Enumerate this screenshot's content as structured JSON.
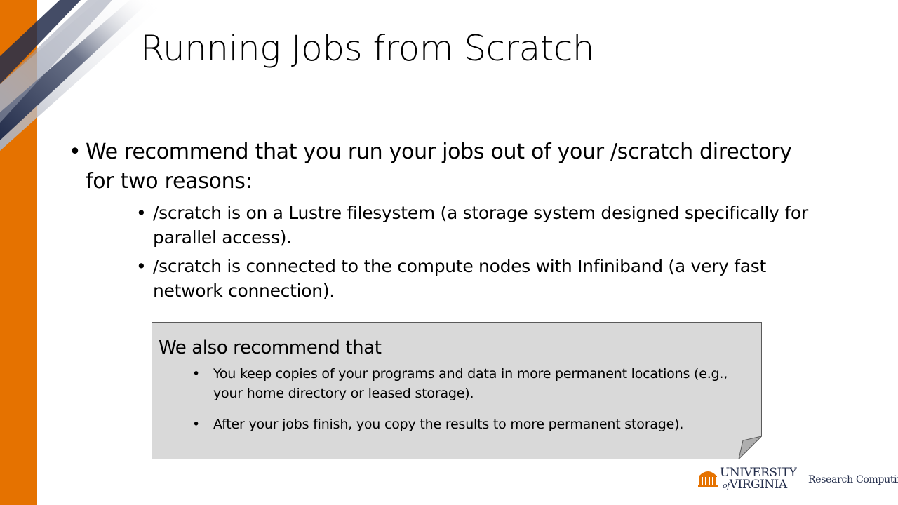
{
  "slide": {
    "title": "Running Jobs from Scratch",
    "main_bullet": "We recommend that you run your jobs out of your /scratch directory for two reasons:",
    "sub_bullets": [
      "/scratch is on a Lustre filesystem (a storage system designed specifically for parallel access).",
      "/scratch is connected to the compute nodes with Infiniband (a very fast network connection)."
    ],
    "bullet_glyph": "•"
  },
  "note": {
    "heading": "We also recommend that",
    "items": [
      "You keep copies of your programs and data in more permanent locations (e.g., your home directory or leased storage).",
      "After your jobs finish, you copy the results to more permanent storage)."
    ]
  },
  "logo": {
    "university_line1": "UNIVERSITY",
    "university_line2": "VIRGINIA",
    "university_of": "of",
    "department": "Research Computing"
  },
  "colors": {
    "accent_orange": "#e57200",
    "navy": "#232d4b",
    "note_fill": "#d9d9d9"
  }
}
